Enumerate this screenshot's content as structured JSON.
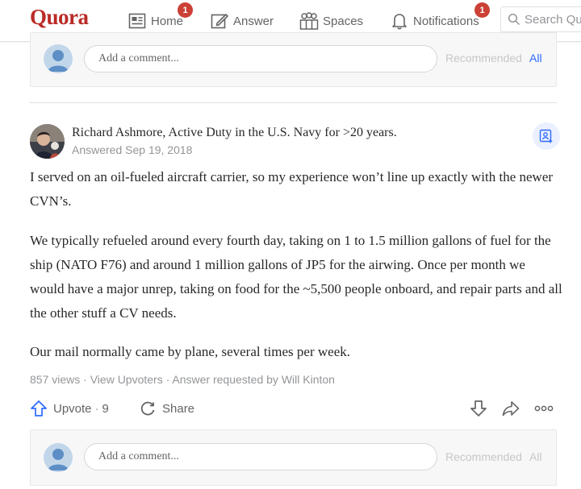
{
  "header": {
    "logo": "Quora",
    "nav": [
      {
        "label": "Home",
        "icon": "home-icon",
        "badge": "1"
      },
      {
        "label": "Answer",
        "icon": "pencil-icon"
      },
      {
        "label": "Spaces",
        "icon": "people-icon"
      },
      {
        "label": "Notifications",
        "icon": "bell-icon",
        "badge": "1"
      }
    ],
    "search_placeholder": "Search Qu"
  },
  "comment_top": {
    "placeholder": "Add a comment...",
    "tab_recommended": "Recommended",
    "tab_all": "All"
  },
  "answer": {
    "author": "Richard Ashmore, Active Duty in the U.S. Navy for >20 years.",
    "answered": "Answered Sep 19, 2018",
    "paragraphs": [
      "I served on an oil-fueled aircraft carrier, so my experience won’t line up exactly with the newer CVN’s.",
      "We typically refueled around every fourth day, taking on 1 to 1.5 million gallons of fuel for the ship (NATO F76) and around 1 million gallons of JP5 for the airwing. Once per month we would have a major unrep, taking on food for the ~5,500 people onboard, and repair parts and all the other stuff a CV needs.",
      "Our mail normally came by plane, several times per week."
    ],
    "views": "857 views",
    "sep": " · ",
    "view_upvoters": "View Upvoters",
    "requested": "Answer requested by Will Kinton",
    "upvote_label": "Upvote",
    "upvote_count": "9",
    "share_label": "Share"
  },
  "comment_bottom": {
    "placeholder": "Add a comment...",
    "tab_recommended": "Recommended",
    "tab_all": "All"
  },
  "colors": {
    "brand": "#b92b27",
    "accent": "#2e69ff",
    "badge": "#cb4136"
  }
}
